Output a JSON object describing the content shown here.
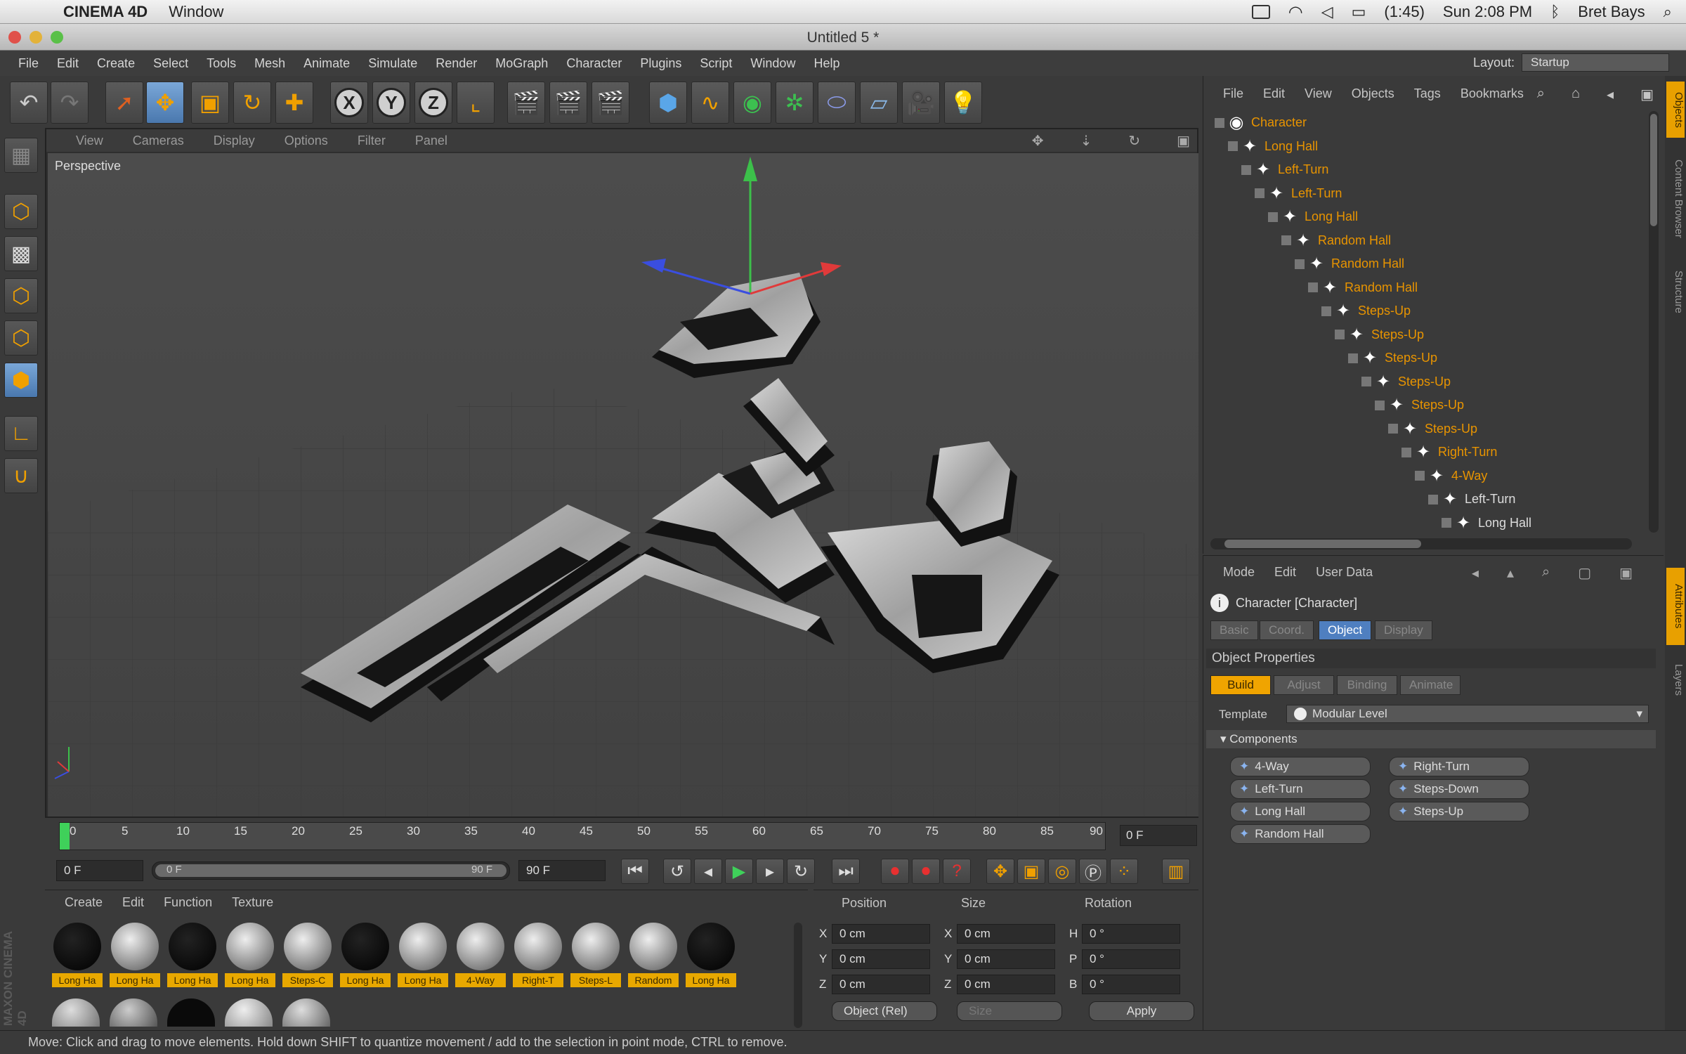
{
  "macbar": {
    "app_name": "CINEMA 4D",
    "menu": "Window",
    "battery": "(1:45)",
    "clock": "Sun 2:08 PM",
    "user": "Bret Bays"
  },
  "window": {
    "title": "Untitled 5 *"
  },
  "app_menu": {
    "items": [
      "File",
      "Edit",
      "Create",
      "Select",
      "Tools",
      "Mesh",
      "Animate",
      "Simulate",
      "Render",
      "MoGraph",
      "Character",
      "Plugins",
      "Script",
      "Window",
      "Help"
    ],
    "layout_label": "Layout:",
    "layout_value": "Startup"
  },
  "viewport": {
    "menu": [
      "View",
      "Cameras",
      "Display",
      "Options",
      "Filter",
      "Panel"
    ],
    "label": "Perspective"
  },
  "timeline": {
    "ticks": [
      "0",
      "5",
      "10",
      "15",
      "20",
      "25",
      "30",
      "35",
      "40",
      "45",
      "50",
      "55",
      "60",
      "65",
      "70",
      "75",
      "80",
      "85",
      "90"
    ],
    "current_frame": "0 F",
    "start_field": "0 F",
    "range_start": "0 F",
    "range_end": "90 F",
    "end_field": "90 F"
  },
  "material_manager": {
    "menu": [
      "Create",
      "Edit",
      "Function",
      "Texture"
    ],
    "materials": [
      {
        "label": "Long Ha",
        "style": "black"
      },
      {
        "label": "Long Ha",
        "style": "stone"
      },
      {
        "label": "Long Ha",
        "style": "black"
      },
      {
        "label": "Long Ha",
        "style": "stone"
      },
      {
        "label": "Steps-C",
        "style": "stone"
      },
      {
        "label": "Long Ha",
        "style": "black"
      },
      {
        "label": "Long Ha",
        "style": "stone"
      },
      {
        "label": "4-Way",
        "style": "stone"
      },
      {
        "label": "Right-T",
        "style": "stone"
      },
      {
        "label": "Steps-L",
        "style": "stone"
      },
      {
        "label": "Random",
        "style": "stone"
      },
      {
        "label": "Long Ha",
        "style": "black"
      }
    ],
    "side_brand": "MAXON CINEMA 4D"
  },
  "coordinates": {
    "headers": [
      "Position",
      "Size",
      "Rotation"
    ],
    "rows": [
      {
        "axis": "X",
        "pos": "0 cm",
        "size_axis": "X",
        "size": "0 cm",
        "rot_axis": "H",
        "rot": "0 °"
      },
      {
        "axis": "Y",
        "pos": "0 cm",
        "size_axis": "Y",
        "size": "0 cm",
        "rot_axis": "P",
        "rot": "0 °"
      },
      {
        "axis": "Z",
        "pos": "0 cm",
        "size_axis": "Z",
        "size": "0 cm",
        "rot_axis": "B",
        "rot": "0 °"
      }
    ],
    "mode": "Object (Rel)",
    "size_mode": "Size",
    "apply": "Apply"
  },
  "object_manager": {
    "menu": [
      "File",
      "Edit",
      "View",
      "Objects",
      "Tags",
      "Bookmarks"
    ],
    "objects": [
      {
        "name": "Character",
        "color": "orange",
        "icon": "character"
      },
      {
        "name": "Long Hall",
        "color": "orange",
        "icon": "puzzle"
      },
      {
        "name": "Left-Turn",
        "color": "orange",
        "icon": "puzzle"
      },
      {
        "name": "Left-Turn",
        "color": "orange",
        "icon": "puzzle"
      },
      {
        "name": "Long Hall",
        "color": "orange",
        "icon": "puzzle"
      },
      {
        "name": "Random Hall",
        "color": "orange",
        "icon": "puzzle"
      },
      {
        "name": "Random Hall",
        "color": "orange",
        "icon": "puzzle"
      },
      {
        "name": "Random Hall",
        "color": "orange",
        "icon": "puzzle"
      },
      {
        "name": "Steps-Up",
        "color": "orange",
        "icon": "puzzle"
      },
      {
        "name": "Steps-Up",
        "color": "orange",
        "icon": "puzzle"
      },
      {
        "name": "Steps-Up",
        "color": "orange",
        "icon": "puzzle"
      },
      {
        "name": "Steps-Up",
        "color": "orange",
        "icon": "puzzle"
      },
      {
        "name": "Steps-Up",
        "color": "orange",
        "icon": "puzzle"
      },
      {
        "name": "Steps-Up",
        "color": "orange",
        "icon": "puzzle"
      },
      {
        "name": "Right-Turn",
        "color": "orange",
        "icon": "puzzle"
      },
      {
        "name": "4-Way",
        "color": "orange",
        "icon": "puzzle"
      },
      {
        "name": "Left-Turn",
        "color": "white",
        "icon": "puzzle"
      },
      {
        "name": "Long Hall",
        "color": "white",
        "icon": "puzzle"
      }
    ]
  },
  "right_tabs": [
    "Objects",
    "Content Browser",
    "Structure",
    "Attributes",
    "Layers"
  ],
  "attribute_manager": {
    "menu": [
      "Mode",
      "Edit",
      "User Data"
    ],
    "object_title": "Character [Character]",
    "tabs": [
      "Basic",
      "Coord.",
      "Object",
      "Display"
    ],
    "active_tab": "Object",
    "section": "Object Properties",
    "subtabs": [
      "Build",
      "Adjust",
      "Binding",
      "Animate"
    ],
    "active_subtab": "Build",
    "template_label": "Template",
    "template_value": "Modular Level",
    "components_label": "Components",
    "components": [
      "4-Way",
      "Right-Turn",
      "Left-Turn",
      "Steps-Down",
      "Long Hall",
      "Steps-Up",
      "Random Hall"
    ]
  },
  "status": "Move: Click and drag to move elements. Hold down SHIFT to quantize movement / add to the selection in point mode, CTRL to remove."
}
